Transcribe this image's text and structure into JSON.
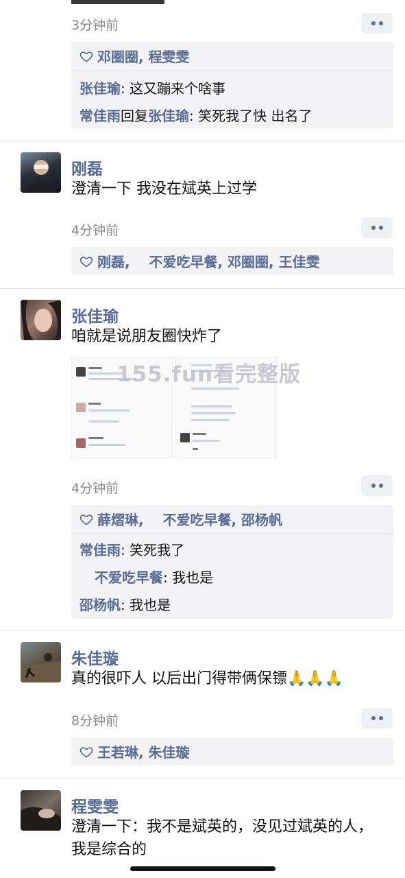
{
  "post0": {
    "time": "3分钟前",
    "likes": "邓圈圈, 程雯雯",
    "comments": [
      {
        "user": "张佳瑜",
        "reply_to": "",
        "text": ": 这又蹦来个啥事"
      },
      {
        "user": "常佳雨",
        "reply_word": "回复",
        "reply_to": "张佳瑜",
        "text": ": 笑死我了快 出名了"
      }
    ]
  },
  "post1": {
    "name": "刚磊",
    "text": "澄清一下 我没在斌英上过学",
    "time": "4分钟前",
    "likes": "刚磊,    不爱吃早餐, 邓圈圈, 王佳雯"
  },
  "post2": {
    "name": "张佳瑜",
    "text": "咱就是说朋友圈快炸了",
    "watermark": "155.fun看完整版",
    "time": "4分钟前",
    "likes": "薛熠琳,    不爱吃早餐, 邵杨帆",
    "comments": [
      {
        "user": "常佳雨",
        "text": ": 笑死我了"
      },
      {
        "user": "不爱吃早餐",
        "text": ": 我也是"
      },
      {
        "user": "邵杨帆",
        "text": ": 我也是"
      }
    ]
  },
  "post3": {
    "name": "朱佳璇",
    "text": "真的很吓人 以后出门得带俩保镖🙏🙏🙏",
    "time": "8分钟前",
    "likes": "王若琳, 朱佳璇"
  },
  "post4": {
    "name": "程雯雯",
    "text": "澄清一下：我不是斌英的，没见过斌英的人，我是综合的"
  }
}
